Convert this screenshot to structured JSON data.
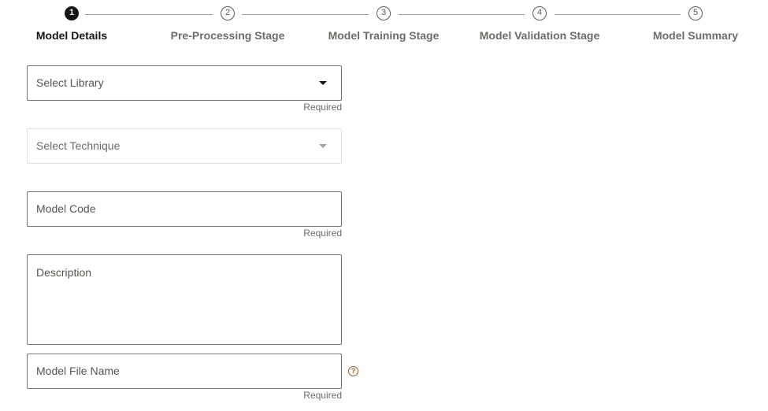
{
  "train": {
    "steps": [
      {
        "number": "1",
        "label": "Model Details",
        "active": true
      },
      {
        "number": "2",
        "label": "Pre-Processing Stage",
        "active": false
      },
      {
        "number": "3",
        "label": "Model Training Stage",
        "active": false
      },
      {
        "number": "4",
        "label": "Model Validation Stage",
        "active": false
      },
      {
        "number": "5",
        "label": "Model Summary",
        "active": false
      }
    ]
  },
  "form": {
    "library": {
      "placeholder": "Select Library",
      "helper": "Required"
    },
    "technique": {
      "placeholder": "Select Technique",
      "disabled": true
    },
    "model_code": {
      "placeholder": "Model Code",
      "helper": "Required"
    },
    "description": {
      "placeholder": "Description"
    },
    "model_file_name": {
      "placeholder": "Model File Name",
      "helper": "Required",
      "help_icon": "?"
    }
  },
  "colors": {
    "active_step": "#161513",
    "help_icon": "#a8551f",
    "field_border": "#77736f"
  }
}
